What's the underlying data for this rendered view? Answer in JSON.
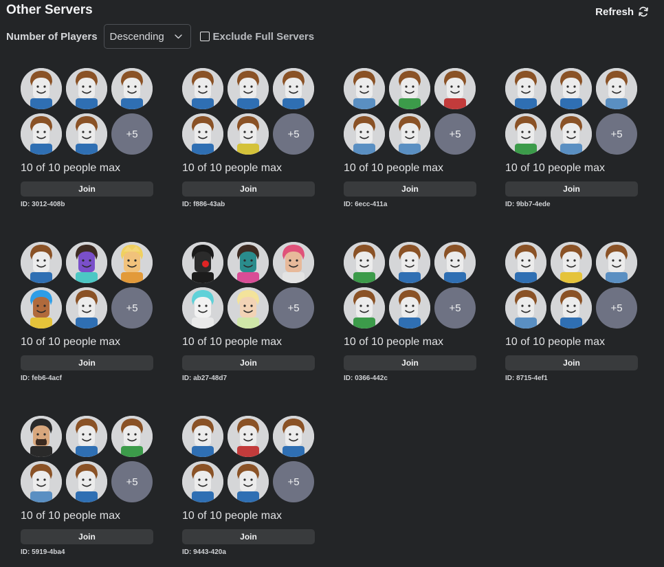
{
  "header": {
    "title": "Other Servers",
    "refresh_label": "Refresh"
  },
  "filters": {
    "sort_label": "Number of Players",
    "sort_value": "Descending",
    "exclude_full_label": "Exclude Full Servers",
    "exclude_full_checked": false
  },
  "servers": [
    {
      "capacity": "10 of 10 people max",
      "join_label": "Join",
      "id": "ID: 3012-408b",
      "more": "+5",
      "avatars": [
        {
          "icon": "classic-avatar-icon",
          "shirt": "#2f6fb3"
        },
        {
          "icon": "classic-avatar-icon",
          "shirt": "#2f6fb3"
        },
        {
          "icon": "classic-avatar-icon",
          "shirt": "#2f6fb3"
        },
        {
          "icon": "classic-avatar-icon",
          "shirt": "#2f6fb3"
        },
        {
          "icon": "classic-avatar-icon",
          "shirt": "#2f6fb3"
        }
      ]
    },
    {
      "capacity": "10 of 10 people max",
      "join_label": "Join",
      "id": "ID: f886-43ab",
      "more": "+5",
      "avatars": [
        {
          "icon": "classic-avatar-icon",
          "shirt": "#2f6fb3"
        },
        {
          "icon": "classic-avatar-icon",
          "shirt": "#2f6fb3"
        },
        {
          "icon": "classic-avatar-icon",
          "shirt": "#2f6fb3"
        },
        {
          "icon": "classic-avatar-icon",
          "shirt": "#2f6fb3"
        },
        {
          "icon": "classic-avatar-icon",
          "shirt": "#d4c23a"
        }
      ]
    },
    {
      "capacity": "10 of 10 people max",
      "join_label": "Join",
      "id": "ID: 6ecc-411a",
      "more": "+5",
      "avatars": [
        {
          "icon": "classic-avatar-icon",
          "shirt": "#5a8fc2"
        },
        {
          "icon": "classic-avatar-icon",
          "shirt": "#3c9b4a"
        },
        {
          "icon": "classic-avatar-icon",
          "shirt": "#c23b3b"
        },
        {
          "icon": "classic-avatar-icon",
          "shirt": "#5a8fc2"
        },
        {
          "icon": "classic-avatar-icon",
          "shirt": "#5a8fc2"
        }
      ]
    },
    {
      "capacity": "10 of 10 people max",
      "join_label": "Join",
      "id": "ID: 9bb7-4ede",
      "more": "+5",
      "avatars": [
        {
          "icon": "classic-avatar-icon",
          "shirt": "#2f6fb3"
        },
        {
          "icon": "classic-avatar-icon",
          "shirt": "#2f6fb3"
        },
        {
          "icon": "classic-avatar-icon",
          "shirt": "#5a8fc2"
        },
        {
          "icon": "classic-avatar-icon",
          "shirt": "#3c9b4a"
        },
        {
          "icon": "classic-avatar-icon",
          "shirt": "#5a8fc2"
        }
      ]
    },
    {
      "capacity": "10 of 10 people max",
      "join_label": "Join",
      "id": "ID: feb6-4acf",
      "more": "+5",
      "avatars": [
        {
          "icon": "classic-avatar-icon",
          "shirt": "#2f6fb3"
        },
        {
          "icon": "purple-avatar-icon",
          "shirt": "#4cc7c4"
        },
        {
          "icon": "gold-crowned-avatar-icon",
          "shirt": "#e29a3a"
        },
        {
          "icon": "blue-hair-avatar-icon",
          "shirt": "#e5c33a"
        },
        {
          "icon": "classic-avatar-icon",
          "shirt": "#2f6fb3"
        }
      ]
    },
    {
      "capacity": "10 of 10 people max",
      "join_label": "Join",
      "id": "ID: ab27-48d7",
      "more": "+5",
      "avatars": [
        {
          "icon": "masked-avatar-icon",
          "shirt": "#1c1c1c"
        },
        {
          "icon": "teal-avatar-icon",
          "shirt": "#d94d96"
        },
        {
          "icon": "pink-hair-avatar-icon",
          "shirt": "#e3e3e3"
        },
        {
          "icon": "cyan-hair-avatar-icon",
          "shirt": "#e9e9e9"
        },
        {
          "icon": "pastel-hair-avatar-icon",
          "shirt": "#cfe6a8"
        }
      ]
    },
    {
      "capacity": "10 of 10 people max",
      "join_label": "Join",
      "id": "ID: 0366-442c",
      "more": "+5",
      "avatars": [
        {
          "icon": "classic-avatar-icon",
          "shirt": "#3c9b4a"
        },
        {
          "icon": "classic-avatar-icon",
          "shirt": "#2f6fb3"
        },
        {
          "icon": "classic-avatar-icon",
          "shirt": "#2f6fb3"
        },
        {
          "icon": "classic-avatar-icon",
          "shirt": "#3c9b4a"
        },
        {
          "icon": "classic-avatar-icon",
          "shirt": "#2f6fb3"
        }
      ]
    },
    {
      "capacity": "10 of 10 people max",
      "join_label": "Join",
      "id": "ID: 8715-4ef1",
      "more": "+5",
      "avatars": [
        {
          "icon": "classic-avatar-icon",
          "shirt": "#2f6fb3"
        },
        {
          "icon": "classic-avatar-icon",
          "shirt": "#e5c33a"
        },
        {
          "icon": "classic-avatar-icon",
          "shirt": "#5a8fc2"
        },
        {
          "icon": "classic-avatar-icon",
          "shirt": "#5a8fc2"
        },
        {
          "icon": "classic-avatar-icon",
          "shirt": "#2f6fb3"
        }
      ]
    },
    {
      "capacity": "10 of 10 people max",
      "join_label": "Join",
      "id": "ID: 5919-4ba4",
      "more": "+5",
      "avatars": [
        {
          "icon": "bearded-avatar-icon",
          "shirt": "#2a2a2a"
        },
        {
          "icon": "classic-avatar-icon",
          "shirt": "#2f6fb3"
        },
        {
          "icon": "classic-avatar-icon",
          "shirt": "#3c9b4a"
        },
        {
          "icon": "classic-avatar-icon",
          "shirt": "#5a8fc2"
        },
        {
          "icon": "classic-avatar-icon",
          "shirt": "#2f6fb3"
        }
      ]
    },
    {
      "capacity": "10 of 10 people max",
      "join_label": "Join",
      "id": "ID: 9443-420a",
      "more": "+5",
      "avatars": [
        {
          "icon": "classic-avatar-icon",
          "shirt": "#2f6fb3"
        },
        {
          "icon": "classic-avatar-icon",
          "shirt": "#c23b3b"
        },
        {
          "icon": "classic-avatar-icon",
          "shirt": "#2f6fb3"
        },
        {
          "icon": "classic-avatar-icon",
          "shirt": "#2f6fb3"
        },
        {
          "icon": "classic-avatar-icon",
          "shirt": "#2f6fb3"
        }
      ]
    }
  ]
}
